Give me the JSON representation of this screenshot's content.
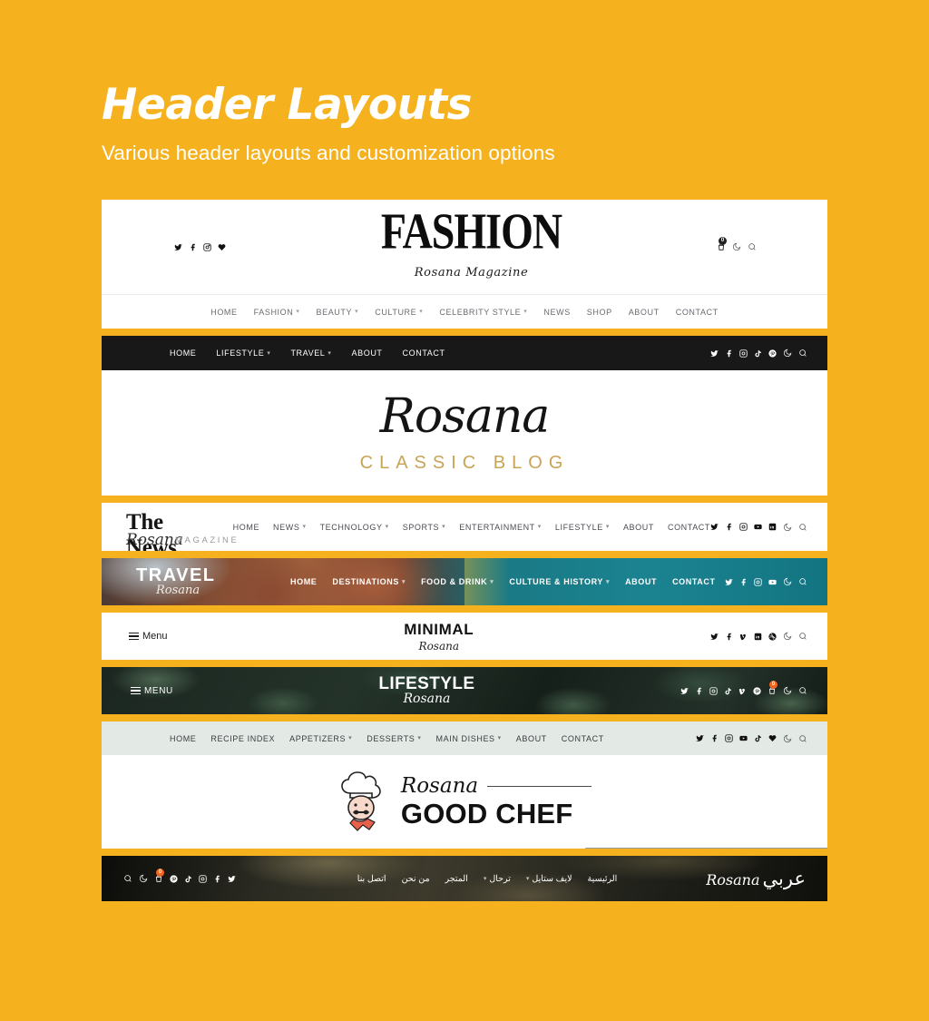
{
  "page": {
    "title": "Header Layouts",
    "subtitle": "Various header layouts and customization options",
    "background_color": "#f5b11e",
    "accent_color": "#f5b11e"
  },
  "headers": {
    "fashion": {
      "logo": "FASHION",
      "tagline": "Rosana Magazine",
      "socials": [
        "twitter-icon",
        "facebook-icon",
        "instagram-icon",
        "heart-icon"
      ],
      "tools": [
        "cart-icon",
        "moon-icon",
        "search-icon"
      ],
      "cart_count": "0",
      "nav": [
        {
          "label": "HOME",
          "has_dropdown": false
        },
        {
          "label": "FASHION",
          "has_dropdown": true
        },
        {
          "label": "BEAUTY",
          "has_dropdown": true
        },
        {
          "label": "CULTURE",
          "has_dropdown": true
        },
        {
          "label": "CELEBRITY STYLE",
          "has_dropdown": true
        },
        {
          "label": "NEWS",
          "has_dropdown": false
        },
        {
          "label": "SHOP",
          "has_dropdown": false
        },
        {
          "label": "ABOUT",
          "has_dropdown": false
        },
        {
          "label": "CONTACT",
          "has_dropdown": false
        }
      ]
    },
    "classic": {
      "logo": "Rosana",
      "subtitle": "CLASSIC BLOG",
      "subtitle_color": "#c8a456",
      "bar_color": "#181818",
      "nav": [
        {
          "label": "HOME",
          "has_dropdown": false
        },
        {
          "label": "LIFESTYLE",
          "has_dropdown": true
        },
        {
          "label": "TRAVEL",
          "has_dropdown": true
        },
        {
          "label": "ABOUT",
          "has_dropdown": false
        },
        {
          "label": "CONTACT",
          "has_dropdown": false
        }
      ],
      "socials": [
        "twitter-icon",
        "facebook-icon",
        "instagram-icon",
        "tiktok-icon",
        "pinterest-icon",
        "moon-icon",
        "search-icon"
      ]
    },
    "news": {
      "logo_line1": "The News",
      "logo_script": "Rosana",
      "logo_word": "MAGAZINE",
      "nav": [
        {
          "label": "HOME",
          "has_dropdown": false
        },
        {
          "label": "NEWS",
          "has_dropdown": true
        },
        {
          "label": "TECHNOLOGY",
          "has_dropdown": true
        },
        {
          "label": "SPORTS",
          "has_dropdown": true
        },
        {
          "label": "ENTERTAINMENT",
          "has_dropdown": true
        },
        {
          "label": "LIFESTYLE",
          "has_dropdown": true
        },
        {
          "label": "ABOUT",
          "has_dropdown": false
        },
        {
          "label": "CONTACT",
          "has_dropdown": false
        }
      ],
      "socials": [
        "twitter-icon",
        "facebook-icon",
        "instagram-icon",
        "youtube-icon",
        "linkedin-icon",
        "moon-icon",
        "search-icon"
      ]
    },
    "travel": {
      "logo": "TRAVEL",
      "logo_script": "Rosana",
      "background_color": "#1a7a86",
      "nav": [
        {
          "label": "HOME",
          "has_dropdown": false
        },
        {
          "label": "DESTINATIONS",
          "has_dropdown": true
        },
        {
          "label": "FOOD & DRINK",
          "has_dropdown": true
        },
        {
          "label": "CULTURE & HISTORY",
          "has_dropdown": true
        },
        {
          "label": "ABOUT",
          "has_dropdown": false
        },
        {
          "label": "CONTACT",
          "has_dropdown": false
        }
      ],
      "socials": [
        "twitter-icon",
        "facebook-icon",
        "instagram-icon",
        "youtube-icon",
        "moon-icon",
        "search-icon"
      ]
    },
    "minimal": {
      "menu_label": "Menu",
      "logo": "MINIMAL",
      "logo_script": "Rosana",
      "socials": [
        "twitter-icon",
        "facebook-icon",
        "vimeo-icon",
        "linkedin-icon",
        "dribbble-icon",
        "moon-icon",
        "search-icon"
      ]
    },
    "lifestyle": {
      "menu_label": "MENU",
      "logo": "LIFESTYLE",
      "logo_script": "Rosana",
      "cart_count": "0",
      "socials": [
        "twitter-icon",
        "facebook-icon",
        "instagram-icon",
        "tiktok-icon",
        "vimeo-icon",
        "pinterest-icon",
        "cart-icon",
        "moon-icon",
        "search-icon"
      ]
    },
    "chef": {
      "logo_script": "Rosana",
      "logo": "GOOD CHEF",
      "nav_background": "#e3eae5",
      "nav": [
        {
          "label": "HOME",
          "has_dropdown": false
        },
        {
          "label": "RECIPE INDEX",
          "has_dropdown": false
        },
        {
          "label": "APPETIZERS",
          "has_dropdown": true
        },
        {
          "label": "DESSERTS",
          "has_dropdown": true
        },
        {
          "label": "MAIN DISHES",
          "has_dropdown": true
        },
        {
          "label": "ABOUT",
          "has_dropdown": false
        },
        {
          "label": "CONTACT",
          "has_dropdown": false
        }
      ],
      "socials": [
        "twitter-icon",
        "facebook-icon",
        "instagram-icon",
        "youtube-icon",
        "tiktok-icon",
        "heart-icon",
        "moon-icon",
        "search-icon"
      ]
    },
    "arabic": {
      "logo_arabic": "عربي",
      "logo_latin": "Rosana",
      "nav": [
        {
          "label": "الرئيسية",
          "has_dropdown": false
        },
        {
          "label": "لايف ستايل",
          "has_dropdown": true
        },
        {
          "label": "ترحال",
          "has_dropdown": true
        },
        {
          "label": "المتجر",
          "has_dropdown": false
        },
        {
          "label": "من نحن",
          "has_dropdown": false
        },
        {
          "label": "اتصل بنا",
          "has_dropdown": false
        }
      ],
      "cart_count": "0",
      "socials": [
        "search-icon",
        "moon-icon",
        "cart-icon",
        "pinterest-icon",
        "tiktok-icon",
        "instagram-icon",
        "facebook-icon",
        "twitter-icon"
      ]
    }
  }
}
